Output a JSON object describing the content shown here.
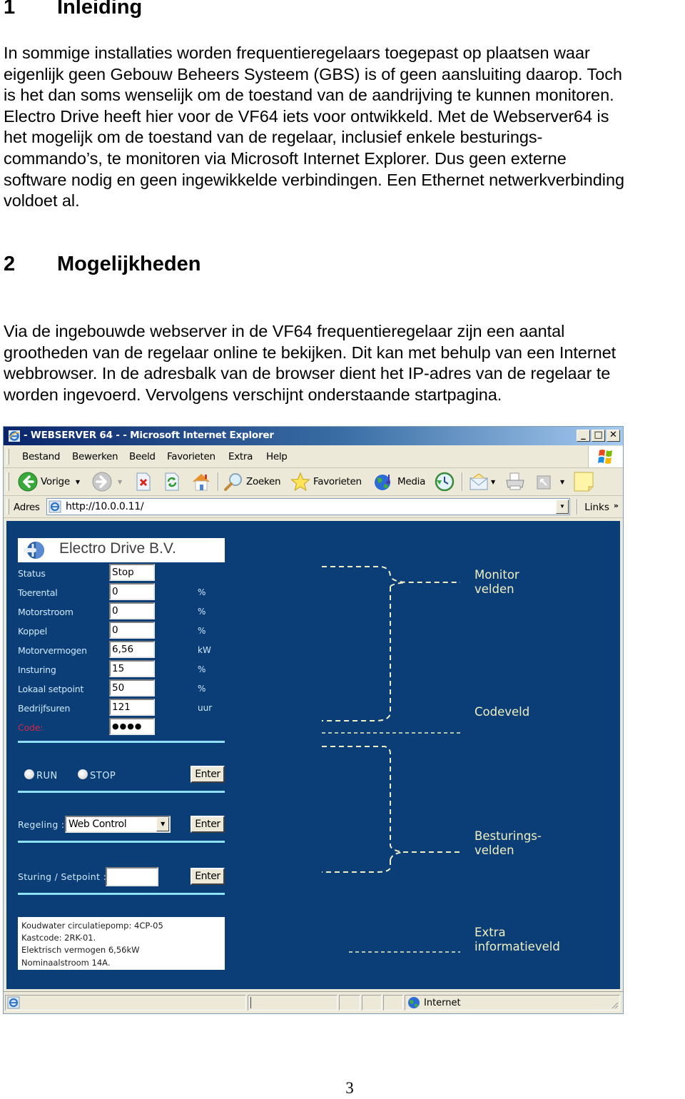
{
  "doc": {
    "section1": {
      "number": "1",
      "title": "Inleiding"
    },
    "paragraph1_lines": [
      "In sommige installaties worden frequentieregelaars toegepast op plaatsen waar",
      "eigenlijk geen Gebouw Beheers Systeem (GBS) is of geen aansluiting daarop. Toch",
      "is het dan soms wenselijk om de toestand van de aandrijving te kunnen monitoren.",
      "Electro Drive heeft hier voor de VF64 iets voor ontwikkeld. Met de Webserver64 is",
      "het mogelijk om de toestand van de regelaar, inclusief enkele besturings-",
      "commando’s, te monitoren via Microsoft Internet Explorer. Dus geen externe",
      "software nodig en geen ingewikkelde verbindingen. Een Ethernet netwerkverbinding",
      "voldoet al."
    ],
    "section2": {
      "number": "2",
      "title": "Mogelijkheden"
    },
    "paragraph2_lines": [
      "Via de ingebouwde webserver in de VF64 frequentieregelaar zijn een aantal",
      "grootheden van de regelaar online te bekijken. Dit kan met behulp van een Internet",
      "webbrowser. In de adresbalk van de browser dient het IP-adres van de regelaar te",
      "worden ingevoerd. Vervolgens verschijnt onderstaande startpagina."
    ],
    "page_number": "3"
  },
  "browser": {
    "title": "- WEBSERVER 64 - - Microsoft Internet Explorer",
    "caption_buttons": {
      "minimize": "_",
      "maximize": "□",
      "close": "✕"
    },
    "menu": [
      "Bestand",
      "Bewerken",
      "Beeld",
      "Favorieten",
      "Extra",
      "Help"
    ],
    "toolbar": {
      "back": "Vorige",
      "search": "Zoeken",
      "favorites": "Favorieten",
      "media": "Media"
    },
    "address": {
      "label": "Adres",
      "url": "http://10.0.0.11/"
    },
    "links_label": "Links",
    "links_chevron": "»",
    "status": {
      "zone": "Internet"
    }
  },
  "webpage": {
    "company": "Electro Drive B.V.",
    "monitor_rows": [
      {
        "label": "Status",
        "value": "Stop",
        "unit": ""
      },
      {
        "label": "Toerental",
        "value": "0",
        "unit": "%"
      },
      {
        "label": "Motorstroom",
        "value": "0",
        "unit": "%"
      },
      {
        "label": "Koppel",
        "value": "0",
        "unit": "%"
      },
      {
        "label": "Motorvermogen",
        "value": "6,56",
        "unit": "kW"
      },
      {
        "label": "Insturing",
        "value": "15",
        "unit": "%"
      },
      {
        "label": "Lokaal setpoint",
        "value": "50",
        "unit": "%"
      },
      {
        "label": "Bedrijfsuren",
        "value": "121",
        "unit": "uur"
      }
    ],
    "code": {
      "label": "Code:",
      "value": "●●●●"
    },
    "run_label": "RUN",
    "stop_label": "STOP",
    "enter_label": "Enter",
    "regeling_label": "Regeling :",
    "regeling_value": "Web Control",
    "setpoint_label": "Sturing / Setpoint :",
    "setpoint_value": "",
    "info_lines": [
      "Koudwater circulatiepomp: 4CP-05",
      "Kastcode: 2RK-01.",
      "Elektrisch vermogen 6,56kW",
      "Nominaalstroom 14A."
    ],
    "annotations": {
      "monitor": [
        "Monitor",
        "velden"
      ],
      "code": [
        "Codeveld"
      ],
      "control": [
        "Besturings-",
        "velden"
      ],
      "extra": [
        "Extra",
        "informatieveld"
      ]
    }
  },
  "colors": {
    "page_bg": "#0b3d77",
    "divider": "#8ee0f4",
    "label_text": "#cfe9ff",
    "code_label": "#d1264a",
    "annotation_text": "#f0f0c0"
  }
}
